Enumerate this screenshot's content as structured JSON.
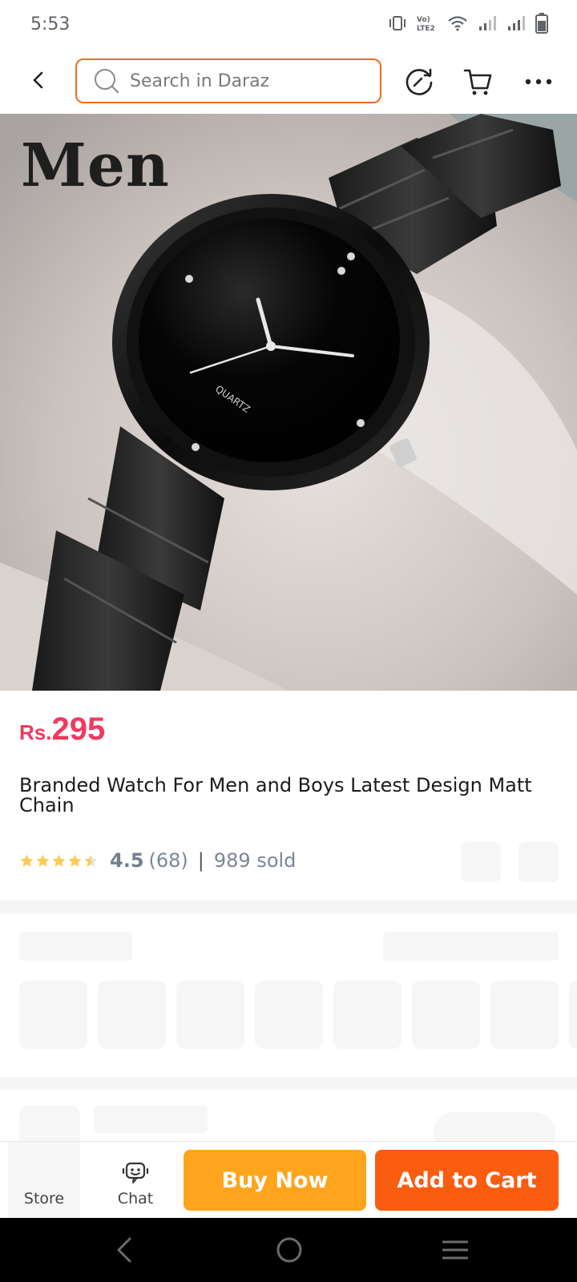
{
  "status_bar": {
    "time": "5:53",
    "network_label": "Vo) LTE2"
  },
  "search": {
    "placeholder": "Search in Daraz"
  },
  "header_icons": [
    "back-arrow-icon",
    "search-icon",
    "history-icon",
    "cart-icon",
    "more-icon"
  ],
  "product": {
    "image_label": "Men",
    "image_dial_text": "QUARTZ",
    "price_currency": "Rs.",
    "price_amount": "295",
    "title": "Branded Watch For Men and Boys Latest Design Matt Chain",
    "rating": "4.5",
    "review_count": "(68)",
    "separator": "|",
    "sold": "989 sold",
    "stars": 4.5
  },
  "bottom_bar": {
    "store_label": "Store",
    "chat_label": "Chat",
    "buy_now_label": "Buy Now",
    "add_to_cart_label": "Add to Cart"
  },
  "colors": {
    "accent": "#f36a1f",
    "price": "#f1395e",
    "buy_now": "#fea51d",
    "add_to_cart": "#fb5d10",
    "star": "#faca51"
  }
}
